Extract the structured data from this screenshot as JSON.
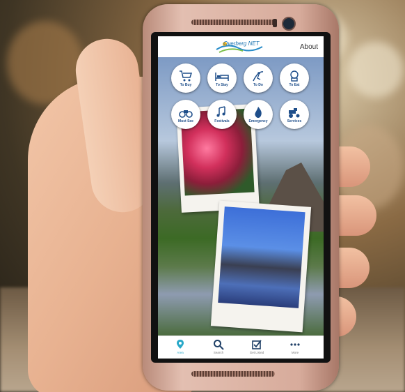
{
  "app": {
    "logo_text": "Overberg NET",
    "about_label": "About"
  },
  "tiles": [
    {
      "label": "To Buy",
      "icon": "cart-icon"
    },
    {
      "label": "To Stay",
      "icon": "bed-icon"
    },
    {
      "label": "To Do",
      "icon": "surfer-icon"
    },
    {
      "label": "To Eat",
      "icon": "chef-icon"
    },
    {
      "label": "Must See",
      "icon": "binoculars-icon"
    },
    {
      "label": "Festivals",
      "icon": "music-notes-icon"
    },
    {
      "label": "Emergency",
      "icon": "flame-icon"
    },
    {
      "label": "Services",
      "icon": "tractor-icon"
    }
  ],
  "bottom_nav": [
    {
      "label": "Area",
      "icon": "map-pin-icon",
      "active": true
    },
    {
      "label": "Search",
      "icon": "search-icon",
      "active": false
    },
    {
      "label": "Get Listed",
      "icon": "checkbox-icon",
      "active": false
    },
    {
      "label": "More",
      "icon": "ellipsis-icon",
      "active": false
    }
  ],
  "colors": {
    "tile_label": "#1e4e8a",
    "nav_active": "#2aa9c9",
    "nav_inactive": "#1e3f66"
  }
}
